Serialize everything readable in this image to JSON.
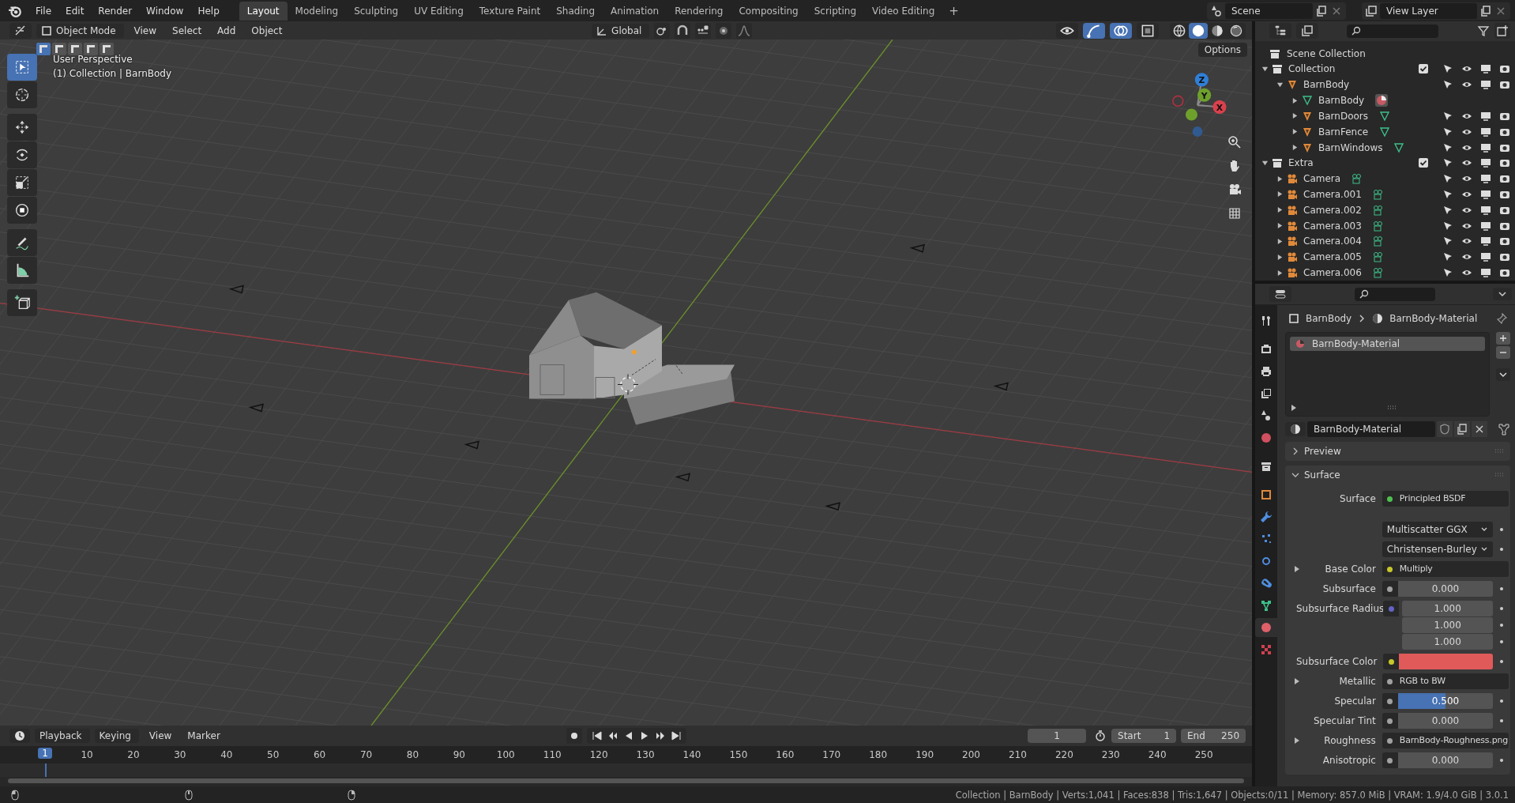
{
  "topbar": {
    "menus": [
      "File",
      "Edit",
      "Render",
      "Window",
      "Help"
    ],
    "workspaces": [
      {
        "label": "Layout",
        "selected": true
      },
      {
        "label": "Modeling",
        "selected": false
      },
      {
        "label": "Sculpting",
        "selected": false
      },
      {
        "label": "UV Editing",
        "selected": false
      },
      {
        "label": "Texture Paint",
        "selected": false
      },
      {
        "label": "Shading",
        "selected": false
      },
      {
        "label": "Animation",
        "selected": false
      },
      {
        "label": "Rendering",
        "selected": false
      },
      {
        "label": "Compositing",
        "selected": false
      },
      {
        "label": "Scripting",
        "selected": false
      },
      {
        "label": "Video Editing",
        "selected": false
      }
    ],
    "add": "+",
    "scene": "Scene",
    "view_layer": "View Layer"
  },
  "viewport": {
    "mode": "Object Mode",
    "menus": [
      "View",
      "Select",
      "Add",
      "Object"
    ],
    "orientation": "Global",
    "options": "Options",
    "select_modes": [
      {
        "selected": true
      },
      {
        "selected": false
      },
      {
        "selected": false
      },
      {
        "selected": false
      },
      {
        "selected": false
      }
    ],
    "toggles": [
      {
        "kind": "visibility",
        "selected": false
      },
      {
        "kind": "gizmos",
        "selected": true
      },
      {
        "kind": "overlays",
        "selected": true
      },
      {
        "kind": "xray",
        "selected": false
      }
    ],
    "shading": [
      {
        "kind": "wireframe",
        "selected": false
      },
      {
        "kind": "solid",
        "selected": true
      },
      {
        "kind": "material",
        "selected": false
      },
      {
        "kind": "rendered",
        "selected": false
      }
    ],
    "overlay_text": [
      "User Perspective",
      "(1) Collection | BarnBody"
    ],
    "tools": [
      {
        "kind": "select",
        "selected": true
      },
      {
        "kind": "cursor",
        "selected": false
      },
      {
        "kind": "move",
        "selected": false
      },
      {
        "kind": "rotate",
        "selected": false
      },
      {
        "kind": "scale",
        "selected": false
      },
      {
        "kind": "transform",
        "selected": false
      },
      {
        "kind": "annotate",
        "selected": false
      },
      {
        "kind": "measure",
        "selected": false
      },
      {
        "kind": "add_cube",
        "selected": false
      }
    ],
    "axes": [
      {
        "label": "Z",
        "color": "#2f7fd8"
      },
      {
        "label": "Y",
        "color": "#6ea12c"
      },
      {
        "label": "X",
        "color": "#d9404d"
      }
    ]
  },
  "outliner": {
    "root": "Scene Collection",
    "tree": [
      {
        "label": "Collection",
        "kind": "collection",
        "expanded": true,
        "checked": true,
        "children": [
          {
            "label": "BarnBody",
            "kind": "object",
            "expanded": true,
            "children": [
              {
                "label": "BarnBody",
                "kind": "mesh",
                "expanded": false
              },
              {
                "label": "BarnDoors",
                "kind": "object",
                "expanded": false
              },
              {
                "label": "BarnFence",
                "kind": "object",
                "expanded": false
              },
              {
                "label": "BarnWindows",
                "kind": "object",
                "expanded": false
              }
            ]
          }
        ]
      },
      {
        "label": "Extra",
        "kind": "collection",
        "expanded": true,
        "checked": true,
        "children": [
          {
            "label": "Camera",
            "kind": "camera",
            "expanded": false
          },
          {
            "label": "Camera.001",
            "kind": "camera",
            "expanded": false
          },
          {
            "label": "Camera.002",
            "kind": "camera",
            "expanded": false
          },
          {
            "label": "Camera.003",
            "kind": "camera",
            "expanded": false
          },
          {
            "label": "Camera.004",
            "kind": "camera",
            "expanded": false
          },
          {
            "label": "Camera.005",
            "kind": "camera",
            "expanded": false
          },
          {
            "label": "Camera.006",
            "kind": "camera",
            "expanded": false
          }
        ]
      }
    ]
  },
  "properties": {
    "tabs": [
      {
        "kind": "tool",
        "selected": false
      },
      {
        "kind": "render",
        "selected": false
      },
      {
        "kind": "output",
        "selected": false
      },
      {
        "kind": "view_layer",
        "selected": false
      },
      {
        "kind": "scene",
        "selected": false
      },
      {
        "kind": "world",
        "selected": false
      },
      {
        "kind": "collection",
        "selected": false
      },
      {
        "kind": "object",
        "selected": false
      },
      {
        "kind": "modifiers",
        "selected": false
      },
      {
        "kind": "particles",
        "selected": false
      },
      {
        "kind": "physics",
        "selected": false
      },
      {
        "kind": "constraints",
        "selected": false
      },
      {
        "kind": "data",
        "selected": false
      },
      {
        "kind": "material",
        "selected": true
      },
      {
        "kind": "texture",
        "selected": false
      }
    ],
    "breadcrumb": [
      "BarnBody",
      "BarnBody-Material"
    ],
    "slots": [
      {
        "label": "BarnBody-Material",
        "selected": true
      }
    ],
    "material": "BarnBody-Material",
    "panels": [
      {
        "label": "Preview",
        "expanded": false
      },
      {
        "label": "Surface",
        "expanded": true
      }
    ],
    "rows": [
      {
        "kind": "link",
        "label": "Surface",
        "value": "Principled BSDF",
        "socket": {
          "color": "#4fc04f"
        },
        "expandable": false
      },
      {
        "kind": "dropdown",
        "value": "Multiscatter GGX",
        "expandable": false
      },
      {
        "kind": "dropdown",
        "value": "Christensen-Burley",
        "expandable": false
      },
      {
        "kind": "link",
        "label": "Base Color",
        "value": "Multiply",
        "socket": {
          "color": "#c7c729"
        },
        "expandable": true
      },
      {
        "kind": "number",
        "label": "Subsurface",
        "value": "0.000",
        "socket": {
          "color": "#a1a1a1"
        },
        "expandable": false
      },
      {
        "kind": "vector",
        "label": "Subsurface Radius",
        "values": [
          "1.000",
          "1.000",
          "1.000"
        ],
        "socket": {
          "color": "#6363c7"
        },
        "expandable": false
      },
      {
        "kind": "swatch",
        "label": "Subsurface Color",
        "swatch": {
          "color": "#e05a5a"
        },
        "socket": {
          "color": "#c7c729"
        },
        "expandable": false
      },
      {
        "kind": "link",
        "label": "Metallic",
        "value": "RGB to BW",
        "socket": {
          "color": "#a1a1a1"
        },
        "expandable": true
      },
      {
        "kind": "slider",
        "label": "Specular",
        "value": "0.500",
        "level": 0.5,
        "socket": {
          "color": "#a1a1a1"
        },
        "expandable": false
      },
      {
        "kind": "number",
        "label": "Specular Tint",
        "value": "0.000",
        "socket": {
          "color": "#a1a1a1"
        },
        "expandable": false
      },
      {
        "kind": "link",
        "label": "Roughness",
        "value": "BarnBody-Roughness.png",
        "socket": {
          "color": "#a1a1a1"
        },
        "expandable": true
      },
      {
        "kind": "number",
        "label": "Anisotropic",
        "value": "0.000",
        "socket": {
          "color": "#a1a1a1"
        },
        "expandable": false
      }
    ]
  },
  "timeline": {
    "menus": [
      "Playback",
      "Keying",
      "View",
      "Marker"
    ],
    "frame": "1",
    "start_label": "Start",
    "start": "1",
    "end_label": "End",
    "end": "250",
    "current": "1",
    "ruler": [
      "10",
      "20",
      "30",
      "40",
      "50",
      "60",
      "70",
      "80",
      "90",
      "100",
      "110",
      "120",
      "130",
      "140",
      "150",
      "160",
      "170",
      "180",
      "190",
      "200",
      "210",
      "220",
      "230",
      "240",
      "250"
    ]
  },
  "status": "Collection | BarnBody | Verts:1,041 | Faces:838 | Tris:1,647 | Objects:0/11 | Memory: 857.0 MiB | VRAM: 1.9/4.0 GiB | 3.0.1"
}
